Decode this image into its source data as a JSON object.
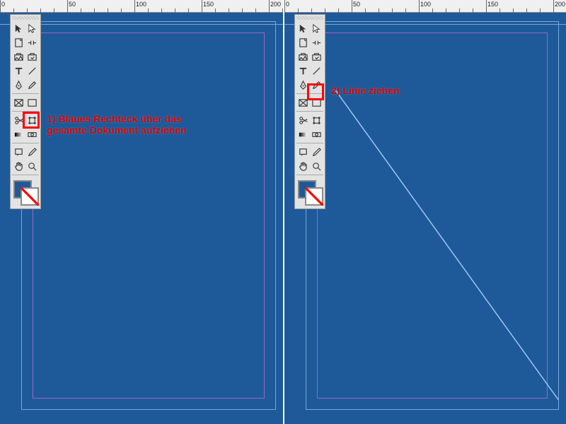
{
  "ruler": {
    "marks": [
      "0",
      "50",
      "100",
      "150",
      "200"
    ]
  },
  "colors": {
    "canvas": "#1e5a99",
    "margin": "#9a66cc",
    "page_border": "#7aa6d8",
    "annotation": "#d40000",
    "toolbox_bg": "#e3e3e3"
  },
  "left": {
    "highlight_tool": "rectangle-frame-tool",
    "annotation": "1) Blaues Rechteck über das gesamte Dokument aufziehen"
  },
  "right": {
    "highlight_tool": "line-tool",
    "annotation": "2) Linie ziehen",
    "has_diagonal_line": true
  },
  "toolbox": {
    "fill_color": "#1e5a99",
    "rows": [
      [
        "selection-tool",
        "direct-selection-tool"
      ],
      [
        "page-tool",
        "gap-tool"
      ],
      [
        "content-collector-tool",
        "content-placer-tool"
      ],
      [
        "type-tool",
        "line-tool"
      ],
      [
        "pen-tool",
        "pencil-tool"
      ],
      [
        "rectangle-frame-tool",
        "rectangle-tool"
      ],
      [
        "scissors-tool",
        "free-transform-tool"
      ],
      [
        "gradient-swatch-tool",
        "gradient-feather-tool"
      ],
      [
        "note-tool",
        "eyedropper-tool"
      ],
      [
        "hand-tool",
        "zoom-tool"
      ]
    ]
  }
}
